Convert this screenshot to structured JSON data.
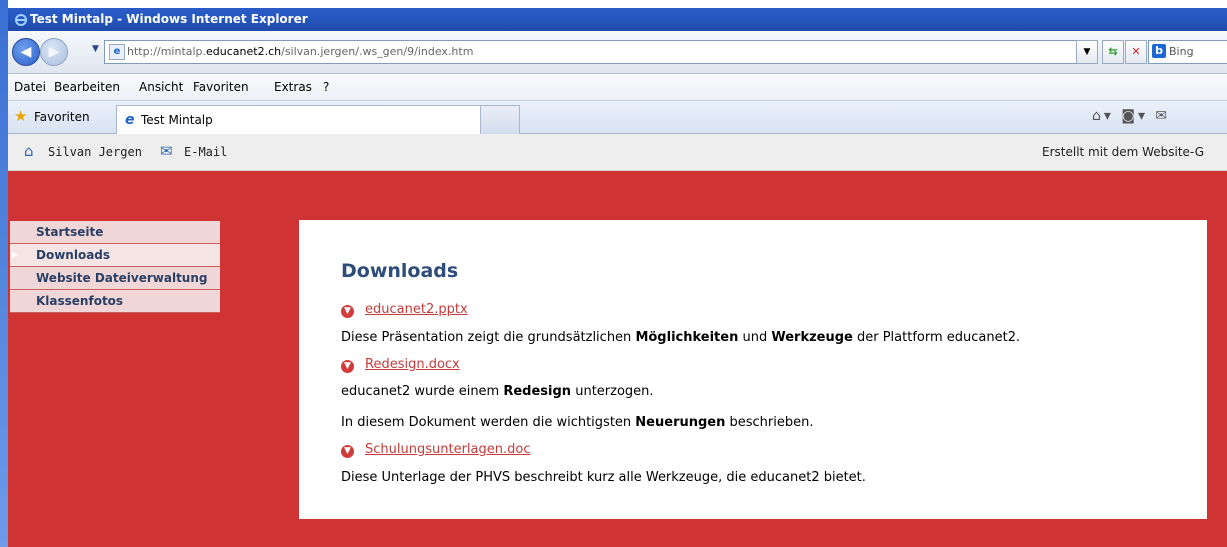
{
  "window": {
    "title": "Test Mintalp - Windows Internet Explorer"
  },
  "address": {
    "url_prefix": "http://mintalp.",
    "url_domain": "educanet2.ch",
    "url_suffix": "/silvan.jergen/.ws_gen/9/index.htm",
    "search_provider": "Bing"
  },
  "menu": [
    "Datei",
    "Bearbeiten",
    "Ansicht",
    "Favoriten",
    "Extras",
    "?"
  ],
  "favorites": {
    "label": "Favoriten",
    "tab_title": "Test Mintalp"
  },
  "site_bar": {
    "owner": "Silvan Jergen",
    "email": "E-Mail",
    "credit": "Erstellt mit dem Website-G"
  },
  "nav": [
    {
      "label": "Startseite",
      "active": false
    },
    {
      "label": "Downloads",
      "active": true
    },
    {
      "label": "Website Dateiverwaltung",
      "active": false
    },
    {
      "label": "Klassenfotos",
      "active": false
    }
  ],
  "content": {
    "heading": "Downloads",
    "item1": {
      "link": "educanet2.pptx",
      "d_pre": "Diese Präsentation zeigt die grundsätzlichen ",
      "d_b1": "Möglichkeiten",
      "d_mid": " und ",
      "d_b2": "Werkzeuge",
      "d_post": " der Plattform educanet2."
    },
    "item2": {
      "link": "Redesign.docx",
      "d_pre": "educanet2 wurde einem ",
      "d_b1": "Redesign",
      "d_post": " unterzogen.",
      "d2_pre": "In diesem Dokument werden die wichtigsten ",
      "d2_b1": "Neuerungen",
      "d2_post": " beschrieben."
    },
    "item3": {
      "link": "Schulungsunterlagen.doc",
      "desc": "Diese Unterlage der PHVS beschreibt kurz alle Werkzeuge, die educanet2 bietet."
    }
  },
  "colors": {
    "site_red": "#d03333",
    "link": "#c63b3b",
    "heading": "#2e4d7b",
    "nav_bg": "#f0d6d6"
  }
}
